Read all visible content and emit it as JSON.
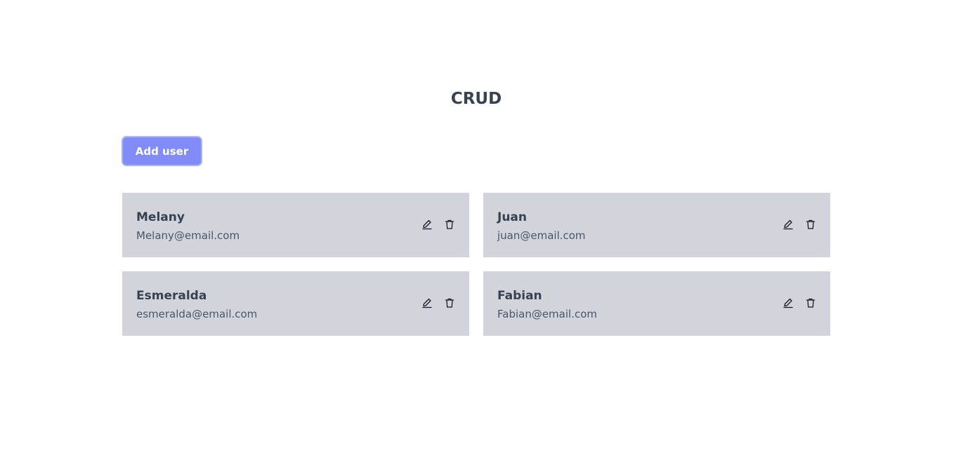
{
  "header": {
    "title": "CRUD"
  },
  "toolbar": {
    "add_user_label": "Add user"
  },
  "users": [
    {
      "name": "Melany",
      "email": "Melany@email.com"
    },
    {
      "name": "Juan",
      "email": "juan@email.com"
    },
    {
      "name": "Esmeralda",
      "email": "esmeralda@email.com"
    },
    {
      "name": "Fabian",
      "email": "Fabian@email.com"
    }
  ],
  "icons": {
    "edit": "pencil-icon",
    "delete": "trash-icon"
  },
  "colors": {
    "accent": "#818cf8",
    "accent_border": "#a5b4fc",
    "card_background": "#d1d5db",
    "text": "#374151"
  }
}
